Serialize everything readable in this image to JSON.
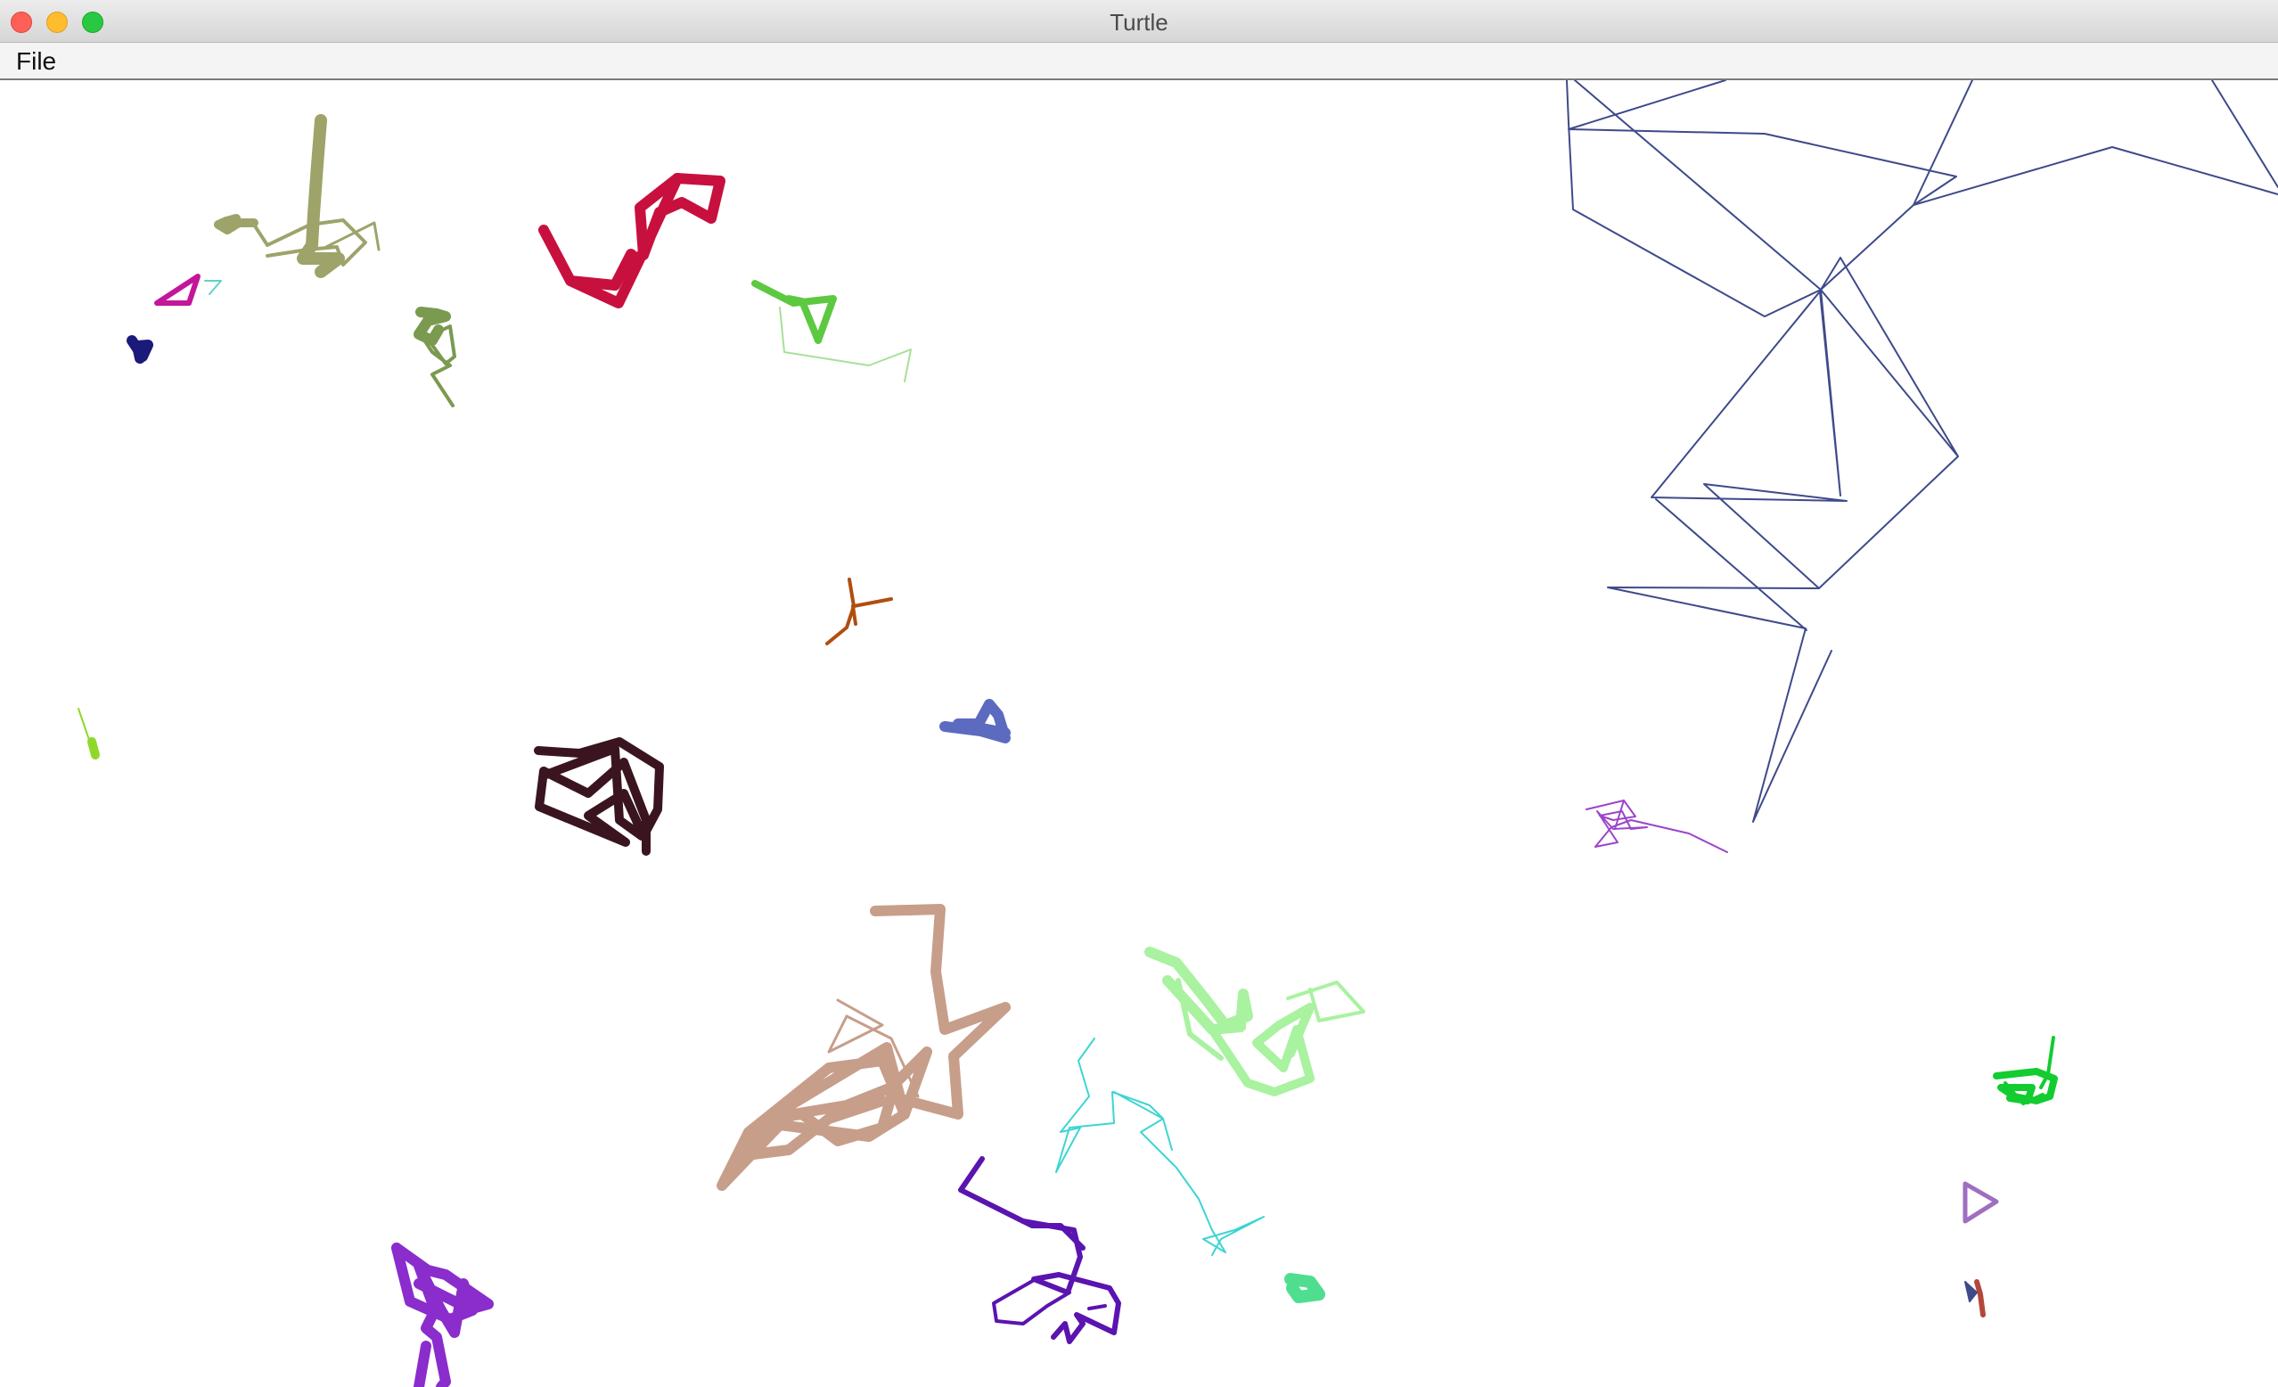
{
  "window": {
    "title": "Turtle"
  },
  "menu": {
    "items": [
      {
        "label": "File"
      }
    ]
  },
  "colors": {
    "titlebar": "#e4e4e4",
    "close": "#fe5f57",
    "minimize": "#febc2e",
    "maximize": "#28c840",
    "canvas_background": "#ffffff"
  },
  "drawing": {
    "description_free": true,
    "turtle_paths": [
      {
        "id": "navy-large",
        "color": "#3e4a8a"
      },
      {
        "id": "olive",
        "color": "#9ea36a"
      },
      {
        "id": "crimson",
        "color": "#c8103e"
      },
      {
        "id": "magenta",
        "color": "#c4169a"
      },
      {
        "id": "teal-small",
        "color": "#5fd3c8"
      },
      {
        "id": "dark-navy",
        "color": "#1a1a7a"
      },
      {
        "id": "moss",
        "color": "#7a9a50"
      },
      {
        "id": "bright-green",
        "color": "#5cc940"
      },
      {
        "id": "rust",
        "color": "#b04e0f"
      },
      {
        "id": "periwinkle",
        "color": "#5c6bc0"
      },
      {
        "id": "lime",
        "color": "#8fd82a"
      },
      {
        "id": "dark-maroon",
        "color": "#3a1520"
      },
      {
        "id": "violet",
        "color": "#9b45c9"
      },
      {
        "id": "tan",
        "color": "#c79e8a"
      },
      {
        "id": "pale-green",
        "color": "#a9f2a0"
      },
      {
        "id": "cyan",
        "color": "#3ed4d4"
      },
      {
        "id": "indigo",
        "color": "#5a14b0"
      },
      {
        "id": "purple",
        "color": "#8a2dcc"
      },
      {
        "id": "mint",
        "color": "#4fde90"
      },
      {
        "id": "green",
        "color": "#12cc30"
      },
      {
        "id": "lavender-turtle",
        "color": "#a06ec0"
      },
      {
        "id": "brick",
        "color": "#b5473a"
      }
    ]
  }
}
